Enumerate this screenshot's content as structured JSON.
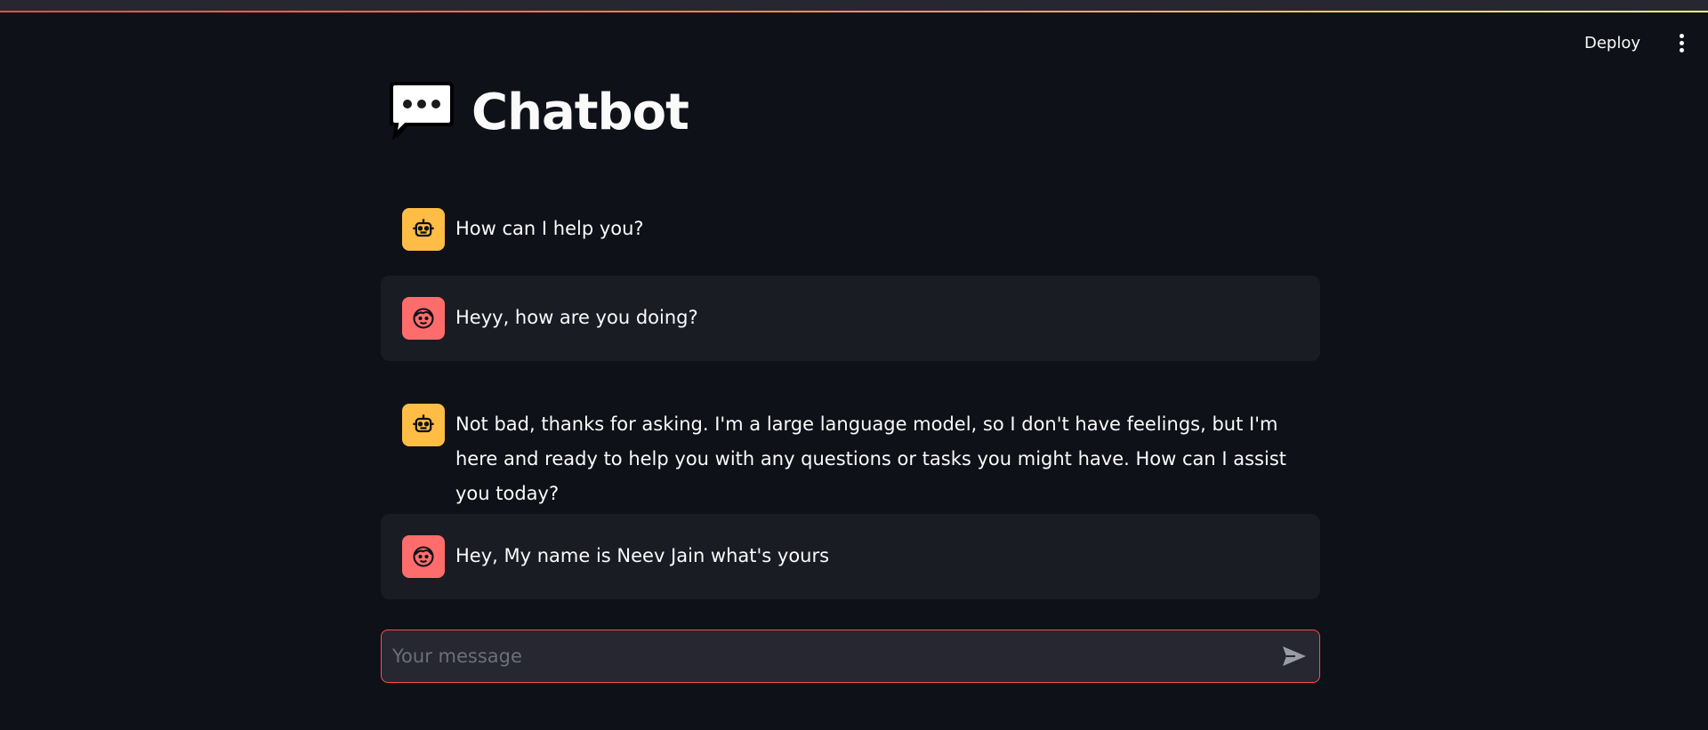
{
  "header": {
    "deploy_label": "Deploy",
    "menu_icon": "vertical-ellipsis-icon"
  },
  "page": {
    "title": "Chatbot",
    "title_icon": "speech-balloon-icon"
  },
  "messages": [
    {
      "role": "assistant",
      "avatar_icon": "robot-icon",
      "text": "How can I help you?"
    },
    {
      "role": "user",
      "avatar_icon": "user-face-icon",
      "text": "Heyy, how are you doing?"
    },
    {
      "role": "assistant",
      "avatar_icon": "robot-icon",
      "text": "Not bad, thanks for asking. I'm a large language model, so I don't have feelings, but I'm here and ready to help you with any questions or tasks you might have. How can I assist you today?"
    },
    {
      "role": "user",
      "avatar_icon": "user-face-icon",
      "text": "Hey, My name is Neev Jain what's yours"
    }
  ],
  "chat_input": {
    "placeholder": "Your message",
    "value": "",
    "send_icon": "send-icon"
  },
  "colors": {
    "background": "#0e1117",
    "user_message_bg": "#1a1c24",
    "bot_avatar": "#ffbd45",
    "user_avatar": "#ff6c6c",
    "input_border": "#ff4b4b"
  }
}
